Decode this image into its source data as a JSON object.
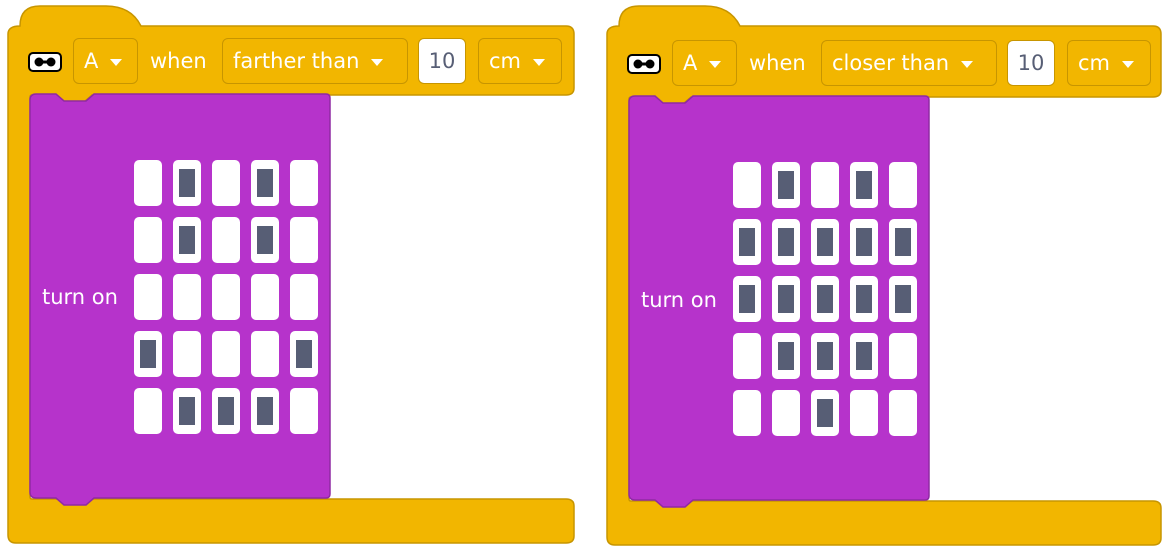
{
  "blocks": [
    {
      "port": "A",
      "when_label": "when",
      "comparison": "farther than",
      "distance_value": "10",
      "unit": "cm",
      "action_label": "turn on",
      "matrix": [
        [
          0,
          1,
          0,
          1,
          0
        ],
        [
          0,
          1,
          0,
          1,
          0
        ],
        [
          0,
          0,
          0,
          0,
          0
        ],
        [
          1,
          0,
          0,
          0,
          1
        ],
        [
          0,
          1,
          1,
          1,
          0
        ]
      ]
    },
    {
      "port": "A",
      "when_label": "when",
      "comparison": "closer than",
      "distance_value": "10",
      "unit": "cm",
      "action_label": "turn on",
      "matrix": [
        [
          0,
          1,
          0,
          1,
          0
        ],
        [
          1,
          1,
          1,
          1,
          1
        ],
        [
          1,
          1,
          1,
          1,
          1
        ],
        [
          0,
          1,
          1,
          1,
          0
        ],
        [
          0,
          0,
          1,
          0,
          0
        ]
      ]
    }
  ],
  "colors": {
    "event_yellow": "#f2b600",
    "event_border": "#c79500",
    "display_purple": "#b633cb",
    "display_border": "#8f2aa3",
    "led_on": "#575e75"
  },
  "icons": {
    "sensor": "distance-sensor-icon",
    "dropdown": "caret-down-icon"
  }
}
